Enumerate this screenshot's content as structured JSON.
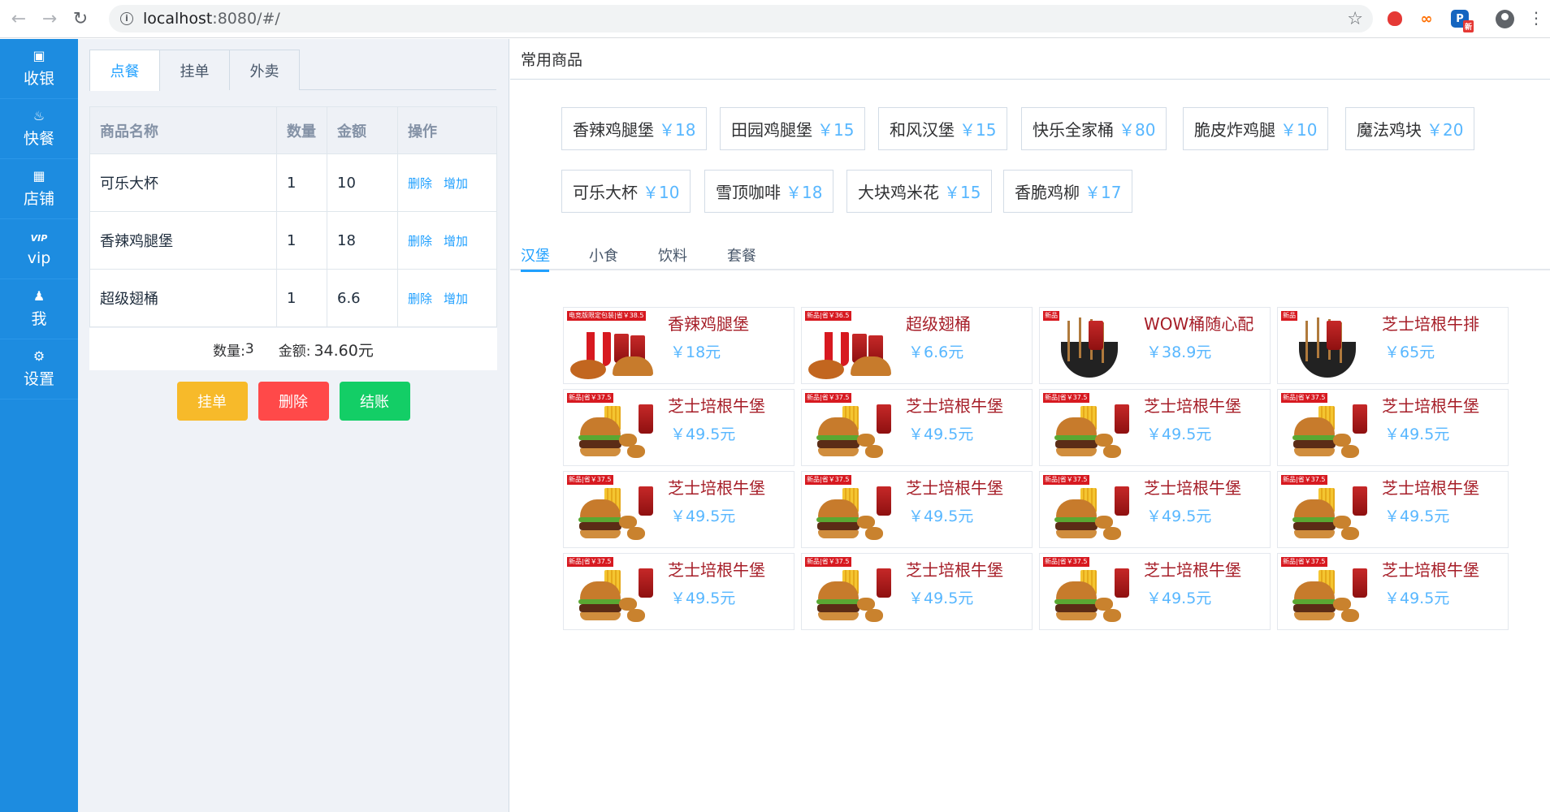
{
  "browser": {
    "url_host": "localhost",
    "url_rest": ":8080/#/"
  },
  "leftnav": [
    {
      "label": "收银",
      "icon": "cash-register-icon"
    },
    {
      "label": "快餐",
      "icon": "fastfood-icon"
    },
    {
      "label": "店铺",
      "icon": "shop-icon"
    },
    {
      "label": "vip",
      "icon": "vip-icon"
    },
    {
      "label": "我",
      "icon": "user-icon"
    },
    {
      "label": "设置",
      "icon": "gear-icon"
    }
  ],
  "order": {
    "tabs": [
      "点餐",
      "挂单",
      "外卖"
    ],
    "active_tab": "点餐",
    "columns": [
      "商品名称",
      "数量",
      "金额",
      "操作"
    ],
    "rows": [
      {
        "name": "可乐大杯",
        "qty": "1",
        "amount": "10"
      },
      {
        "name": "香辣鸡腿堡",
        "qty": "1",
        "amount": "18"
      },
      {
        "name": "超级翅桶",
        "qty": "1",
        "amount": "6.6"
      }
    ],
    "op_delete": "删除",
    "op_add": "增加",
    "count_label": "数量:",
    "count_value": "3",
    "amount_label": "金额:",
    "amount_value": "34.60元",
    "btn_hang": "挂单",
    "btn_delete": "删除",
    "btn_pay": "结账"
  },
  "common": {
    "title": "常用商品",
    "items": [
      {
        "name": "香辣鸡腿堡",
        "price": "￥18"
      },
      {
        "name": "田园鸡腿堡",
        "price": "￥15"
      },
      {
        "name": "和风汉堡",
        "price": "￥15"
      },
      {
        "name": "快乐全家桶",
        "price": "￥80"
      },
      {
        "name": "脆皮炸鸡腿",
        "price": "￥10"
      },
      {
        "name": "魔法鸡块",
        "price": "￥20"
      },
      {
        "name": "可乐大杯",
        "price": "￥10"
      },
      {
        "name": "雪顶咖啡",
        "price": "￥18"
      },
      {
        "name": "大块鸡米花",
        "price": "￥15"
      },
      {
        "name": "香脆鸡柳",
        "price": "￥17"
      }
    ]
  },
  "categories": [
    "汉堡",
    "小食",
    "饮料",
    "套餐"
  ],
  "active_category": "汉堡",
  "goods": [
    {
      "name": "香辣鸡腿堡",
      "price": "￥18元",
      "tag": "电竞版限定包装|省￥38.5",
      "kind": "bucket"
    },
    {
      "name": "超级翅桶",
      "price": "￥6.6元",
      "tag": "新品|省￥36.5",
      "kind": "bucket"
    },
    {
      "name": "WOW桶随心配",
      "price": "￥38.9元",
      "tag": "新品",
      "kind": "bowl"
    },
    {
      "name": "芝士培根牛排",
      "price": "￥65元",
      "tag": "新品",
      "kind": "bowl"
    },
    {
      "name": "芝士培根牛堡",
      "price": "￥49.5元",
      "tag": "新品|省￥37.5",
      "kind": "burger"
    },
    {
      "name": "芝士培根牛堡",
      "price": "￥49.5元",
      "tag": "新品|省￥37.5",
      "kind": "burger"
    },
    {
      "name": "芝士培根牛堡",
      "price": "￥49.5元",
      "tag": "新品|省￥37.5",
      "kind": "burger"
    },
    {
      "name": "芝士培根牛堡",
      "price": "￥49.5元",
      "tag": "新品|省￥37.5",
      "kind": "burger"
    },
    {
      "name": "芝士培根牛堡",
      "price": "￥49.5元",
      "tag": "新品|省￥37.5",
      "kind": "burger"
    },
    {
      "name": "芝士培根牛堡",
      "price": "￥49.5元",
      "tag": "新品|省￥37.5",
      "kind": "burger"
    },
    {
      "name": "芝士培根牛堡",
      "price": "￥49.5元",
      "tag": "新品|省￥37.5",
      "kind": "burger"
    },
    {
      "name": "芝士培根牛堡",
      "price": "￥49.5元",
      "tag": "新品|省￥37.5",
      "kind": "burger"
    },
    {
      "name": "芝士培根牛堡",
      "price": "￥49.5元",
      "tag": "新品|省￥37.5",
      "kind": "burger"
    },
    {
      "name": "芝士培根牛堡",
      "price": "￥49.5元",
      "tag": "新品|省￥37.5",
      "kind": "burger"
    },
    {
      "name": "芝士培根牛堡",
      "price": "￥49.5元",
      "tag": "新品|省￥37.5",
      "kind": "burger"
    },
    {
      "name": "芝士培根牛堡",
      "price": "￥49.5元",
      "tag": "新品|省￥37.5",
      "kind": "burger"
    }
  ],
  "colors": {
    "nav_bg": "#1d8ce0",
    "accent": "#20a0ff",
    "price": "#58b7ff",
    "goods_name": "#a61e28",
    "btn_hang": "#f7ba2a",
    "btn_delete": "#ff4949",
    "btn_pay": "#13ce66"
  }
}
